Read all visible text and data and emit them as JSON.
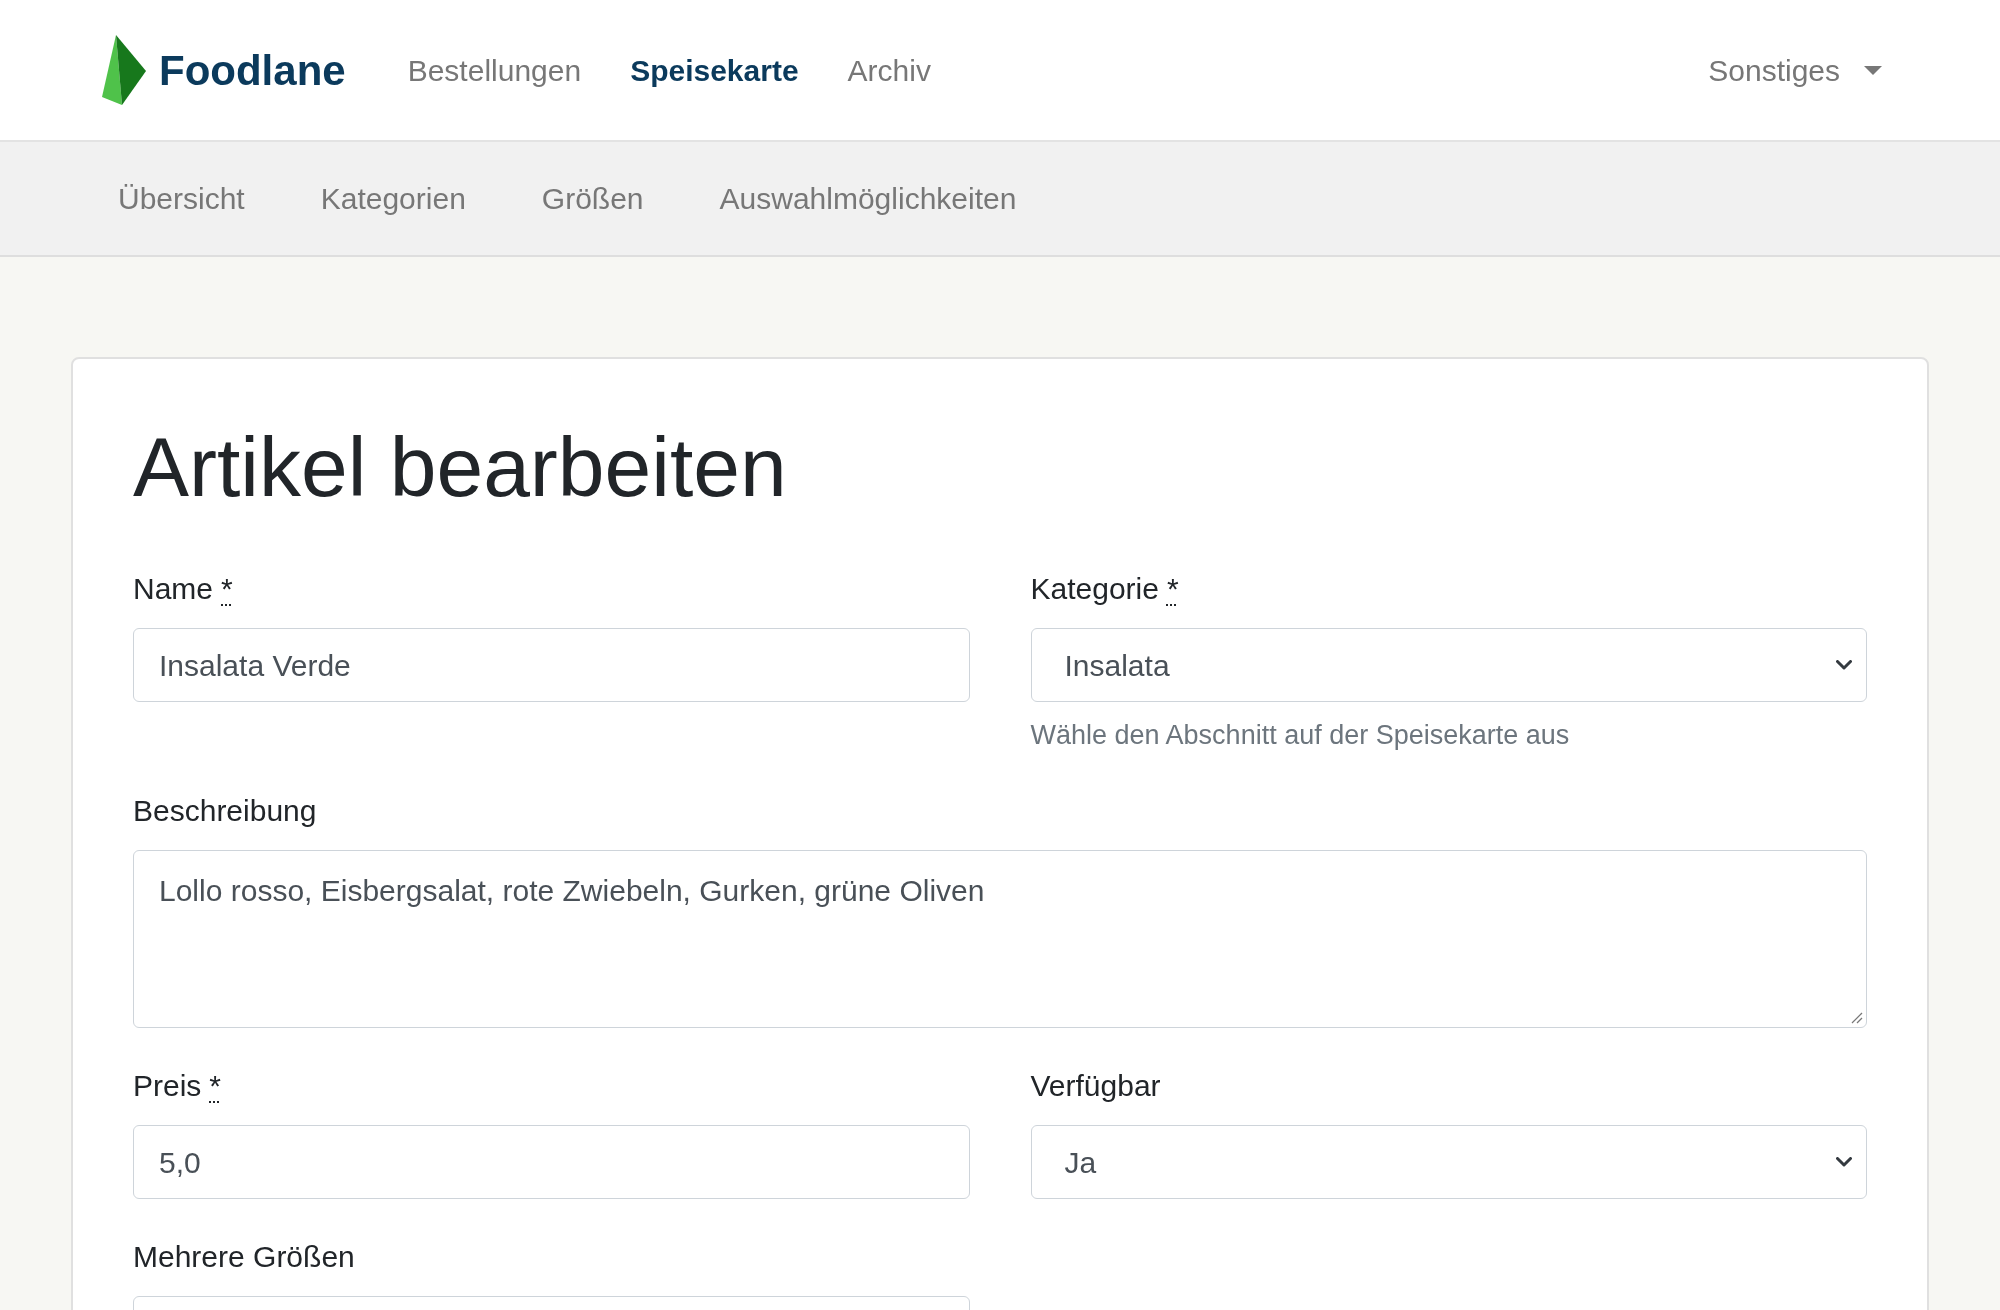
{
  "brand": {
    "name": "Foodlane"
  },
  "nav": {
    "items": [
      {
        "label": "Bestellungen",
        "selected": false
      },
      {
        "label": "Speisekarte",
        "selected": true
      },
      {
        "label": "Archiv",
        "selected": false
      }
    ],
    "dropdown": {
      "label": "Sonstiges"
    }
  },
  "subnav": {
    "items": [
      {
        "label": "Übersicht",
        "selected": false
      },
      {
        "label": "Kategorien",
        "selected": false
      },
      {
        "label": "Größen",
        "selected": false
      },
      {
        "label": "Auswahlmöglichkeiten",
        "selected": false
      }
    ]
  },
  "page": {
    "title": "Artikel bearbeiten"
  },
  "form": {
    "fields": [
      {
        "kind": "text",
        "label": "Name",
        "required_mark": "*",
        "value": "Insalata Verde"
      },
      {
        "kind": "select",
        "label": "Kategorie",
        "required_mark": "*",
        "value": "Insalata",
        "help": "Wähle den Abschnitt auf der Speisekarte aus"
      },
      {
        "kind": "textarea",
        "label": "Beschreibung",
        "value": "Lollo rosso, Eisbergsalat, rote Zwiebeln, Gurken, grüne Oliven"
      },
      {
        "kind": "text",
        "label": "Preis",
        "required_mark": "*",
        "value": "5,0"
      },
      {
        "kind": "select",
        "label": "Verfügbar",
        "value": "Ja"
      },
      {
        "kind": "text",
        "label": "Mehrere Größen"
      }
    ]
  }
}
